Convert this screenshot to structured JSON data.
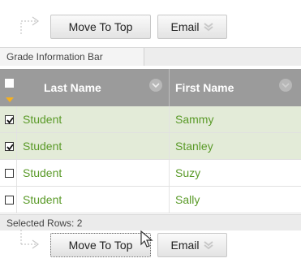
{
  "actions": {
    "move_to_top_label": "Move To Top",
    "email_label": "Email"
  },
  "info_bar": {
    "label": "Grade Information Bar"
  },
  "table": {
    "columns": [
      "Last Name",
      "First Name"
    ],
    "rows": [
      {
        "last": "Student",
        "first": "Sammy",
        "checked": true
      },
      {
        "last": "Student",
        "first": "Stanley",
        "checked": true
      },
      {
        "last": "Student",
        "first": "Suzy",
        "checked": false
      },
      {
        "last": "Student",
        "first": "Sally",
        "checked": false
      }
    ]
  },
  "footer": {
    "selected_rows": "Selected Rows: 2"
  },
  "colors": {
    "name_text": "#5a9a28",
    "header_bg": "#9b9b9b",
    "selected_row_bg": "#e3ebd8"
  }
}
